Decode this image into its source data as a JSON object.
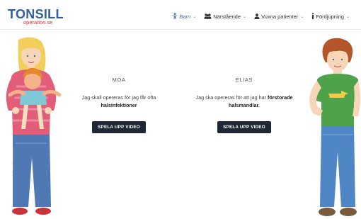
{
  "logo": {
    "main": "TONSILL",
    "sub": "operation.se"
  },
  "nav": {
    "items": [
      {
        "icon": "child-icon",
        "label": "Barn",
        "active": true
      },
      {
        "icon": "group-icon",
        "label": "Närstående",
        "active": false
      },
      {
        "icon": "person-icon",
        "label": "Vuxna patienter",
        "active": false
      },
      {
        "icon": "info-icon",
        "label": "Fördjupning",
        "active": false
      }
    ]
  },
  "cards": {
    "moa": {
      "name": "MOA",
      "desc_line1": "Jag skall opereras för jag får ofta",
      "desc_bold": "halsinfektioner",
      "button": "SPELA UPP VIDEO"
    },
    "elias": {
      "name": "ELIAS",
      "desc_line1": "Jag ska opereras för att jag har",
      "desc_bold1": "förstorade",
      "desc_bold2": "halsmandlar.",
      "button": "SPELA UPP VIDEO"
    }
  },
  "colors": {
    "brand_blue": "#2f5f9e",
    "brand_red": "#d2343a",
    "button_bg": "#1e2733",
    "nav_active": "#3e6fb4"
  }
}
